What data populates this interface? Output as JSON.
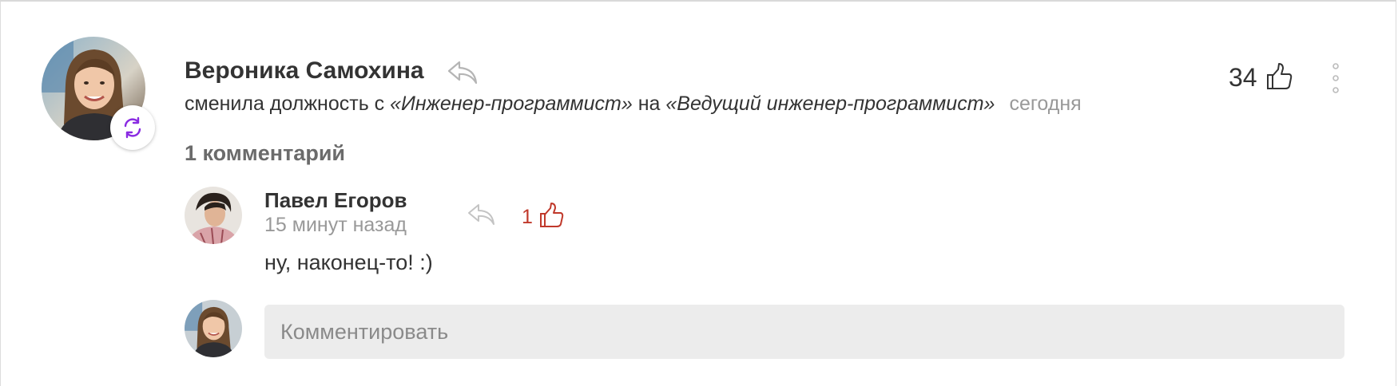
{
  "post": {
    "author_name": "Вероника Самохина",
    "event_prefix": "сменила должность с ",
    "old_position": "«Инженер-программист»",
    "event_middle": " на ",
    "new_position": "«Ведущий инженер-программист»",
    "time": "сегодня",
    "likes": "34",
    "badge_icon": "refresh-icon",
    "accent_color": "#8a2be2"
  },
  "comments": {
    "count_label": "1 комментарий",
    "items": [
      {
        "author": "Павел Егоров",
        "time": "15 минут назад",
        "likes": "1",
        "text": "ну, наконец-то! :)",
        "likes_color": "#c0392b"
      }
    ]
  },
  "composer": {
    "placeholder": "Комментировать",
    "background": "#ececec"
  }
}
